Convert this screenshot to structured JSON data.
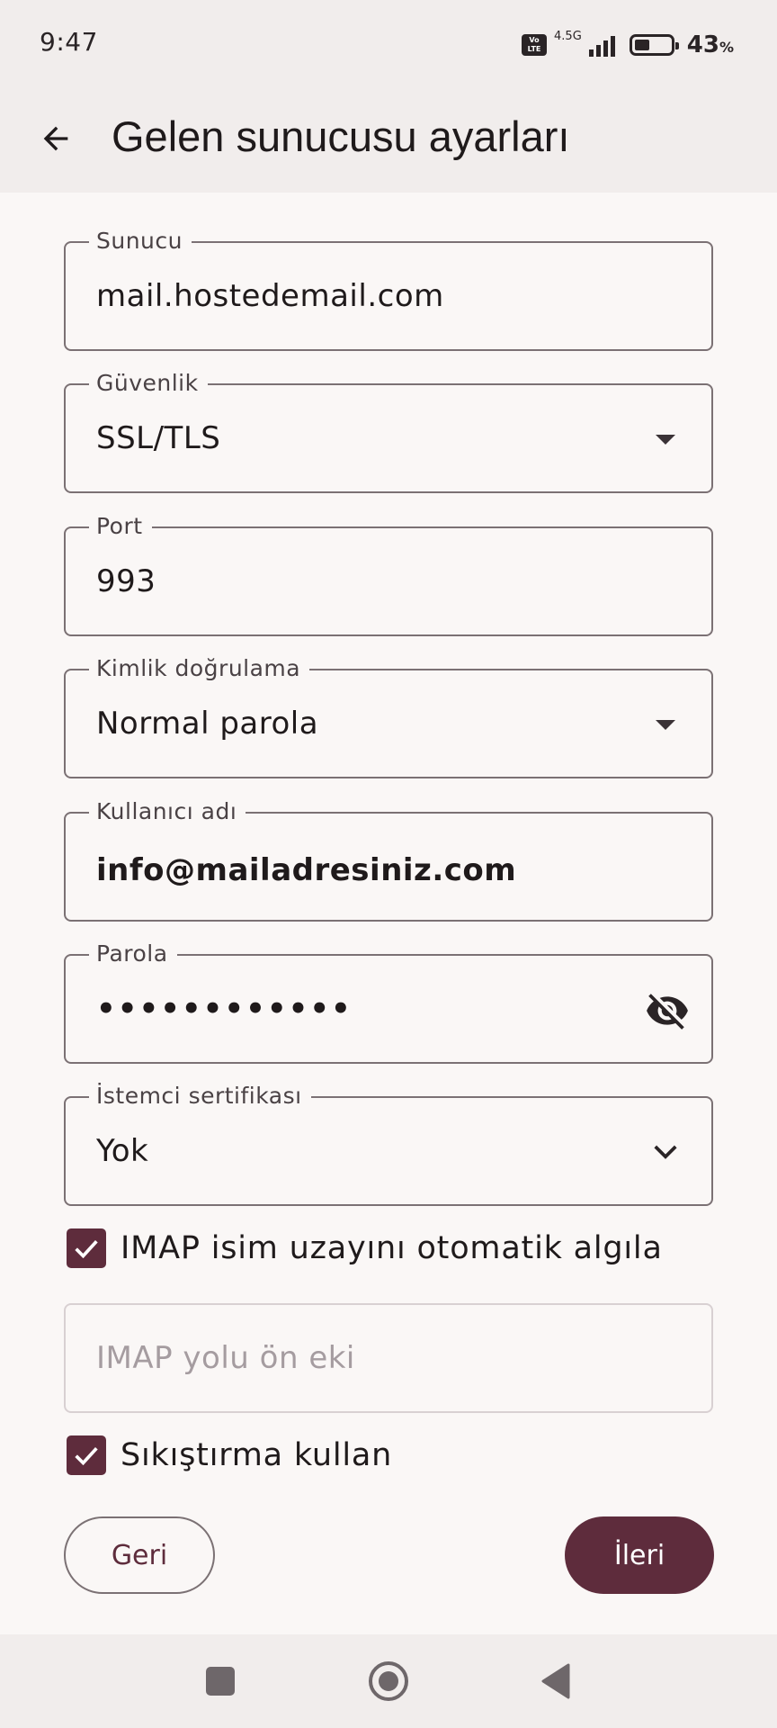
{
  "status_bar": {
    "time": "9:47",
    "volte": "Vo LTE",
    "network": "4.5G",
    "battery_percent": "43",
    "battery_unit": "%",
    "battery_level": 0.43
  },
  "app_bar": {
    "title": "Gelen sunucusu ayarları",
    "back_icon": "arrow-back-icon"
  },
  "fields": {
    "server": {
      "label": "Sunucu",
      "value": "mail.hostedemail.com"
    },
    "security": {
      "label": "Güvenlik",
      "value": "SSL/TLS"
    },
    "port": {
      "label": "Port",
      "value": "993"
    },
    "auth": {
      "label": "Kimlik doğrulama",
      "value": "Normal parola"
    },
    "username": {
      "label": "Kullanıcı adı",
      "value": "info@mailadresiniz.com"
    },
    "password": {
      "label": "Parola",
      "value": "••••••••••••"
    },
    "client_cert": {
      "label": "İstemci sertifikası",
      "value": "Yok"
    },
    "imap_prefix": {
      "placeholder": "IMAP yolu ön eki"
    }
  },
  "checkboxes": {
    "imap_autodetect": {
      "label": "IMAP isim uzayını otomatik algıla",
      "checked": true
    },
    "compression": {
      "label": "Sıkıştırma kullan",
      "checked": true
    }
  },
  "buttons": {
    "back_label": "Geri",
    "next_label": "İleri"
  },
  "colors": {
    "primary": "#5e2c3c",
    "background": "#faf7f6",
    "surface": "#f1edec"
  }
}
